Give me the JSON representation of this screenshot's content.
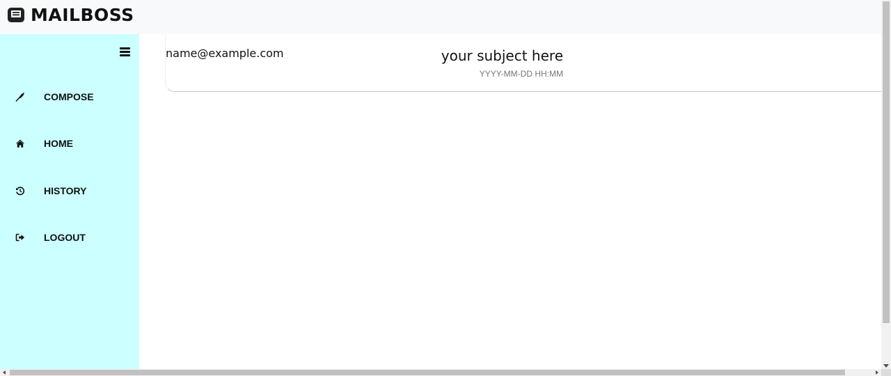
{
  "app": {
    "brand_name": "MAILBOSS",
    "brand_icon": "envelope-open-text-icon"
  },
  "sidebar": {
    "background": "#ccffff",
    "toggle_icon": "hamburger-menu-icon",
    "items": [
      {
        "label": "COMPOSE",
        "icon": "feather-icon"
      },
      {
        "label": "HOME",
        "icon": "home-icon"
      },
      {
        "label": "HISTORY",
        "icon": "history-icon"
      },
      {
        "label": "LOGOUT",
        "icon": "sign-out-icon"
      }
    ]
  },
  "mail_list": [
    {
      "from": "name@example.com",
      "subject": "your subject here",
      "date": "YYYY-MM-DD HH:MM"
    }
  ],
  "colors": {
    "topbar": "#f8f9fa",
    "sidebar": "#ccffff",
    "date_text": "#777777"
  }
}
